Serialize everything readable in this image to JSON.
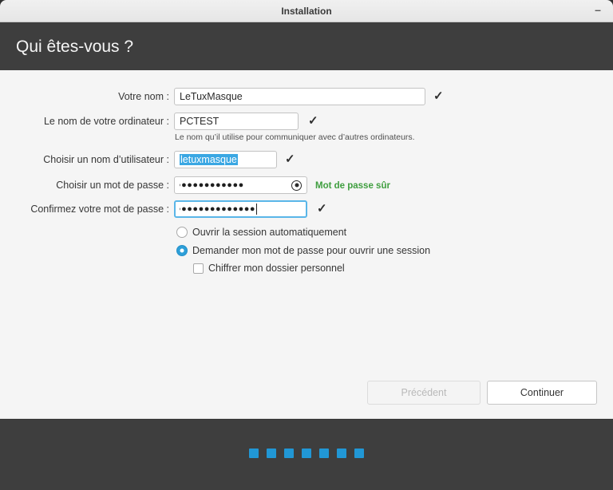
{
  "window": {
    "title": "Installation",
    "minimize_glyph": "–"
  },
  "header": {
    "title": "Qui êtes-vous ?"
  },
  "icons": {
    "check": "✓"
  },
  "form": {
    "name": {
      "label": "Votre nom :",
      "value": "LeTuxMasque"
    },
    "computer": {
      "label": "Le nom de votre ordinateur :",
      "value": "PCTEST",
      "help": "Le nom qu’il utilise pour communiquer avec d’autres ordinateurs."
    },
    "username": {
      "label": "Choisir un nom d’utilisateur :",
      "value": "letuxmasque"
    },
    "password": {
      "label": "Choisir un mot de passe :",
      "masked_value": "●●●●●●●●●●●●",
      "strength": "Mot de passe sûr"
    },
    "confirm": {
      "label": "Confirmez votre mot de passe :",
      "masked_value": "●●●●●●●●●●●●●●"
    },
    "options": {
      "autologin_label": "Ouvrir la session automatiquement",
      "require_password_label": "Demander mon mot de passe pour ouvrir une session",
      "encrypt_home_label": "Chiffrer mon dossier personnel"
    }
  },
  "buttons": {
    "back_label": "Précédent",
    "continue_label": "Continuer"
  },
  "footer": {
    "progress_squares": 7
  },
  "colors": {
    "accent_blue": "#2d9fd8",
    "success_green": "#3f9e3f",
    "selection_blue": "#3aa7e3"
  }
}
